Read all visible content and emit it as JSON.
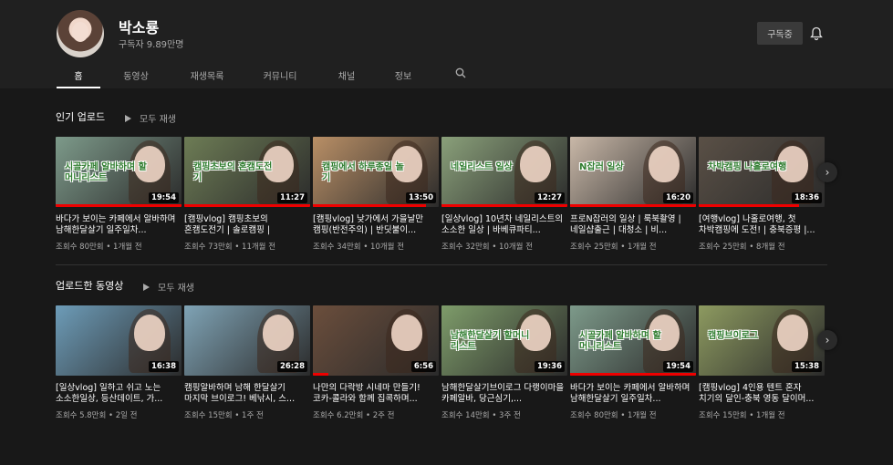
{
  "channel": {
    "name": "박소룡",
    "subscribers": "구독자 9.89만명",
    "subscribe_label": "구독중"
  },
  "tabs": [
    "홈",
    "동영상",
    "재생목록",
    "커뮤니티",
    "채널",
    "정보"
  ],
  "sections": [
    {
      "title": "인기 업로드",
      "play_all": "모두 재생",
      "videos": [
        {
          "title": "바다가 보이는 카페에서 알바하며 남해한달살기 일주일차...",
          "meta": "조회수 80만회 • 1개월 전",
          "duration": "19:54",
          "overlay": "시골카페 알바하며 할머니리스트",
          "thumb": "#7d9a8a",
          "progress": 1.0
        },
        {
          "title": "[캠핑vlog] 캠핑초보의 혼캠도전기 | 솔로캠핑 | 브이로그...",
          "meta": "조회수 73만회 • 11개월 전",
          "duration": "11:27",
          "overlay": "캠핑초보의 혼캠도전기",
          "thumb": "#6d7c55",
          "progress": 1.0
        },
        {
          "title": "[캠핑vlog] 낮가에서 가을날만 캠핑(반전주의) | 반딧불이...",
          "meta": "조회수 34만회 • 10개월 전",
          "duration": "13:50",
          "overlay": "캠핑에서 하루종일 놀기",
          "thumb": "#b98f66",
          "progress": 0.9
        },
        {
          "title": "[일상vlog] 10년차 네일리스트의 소소한 일상 | 바베큐파티...",
          "meta": "조회수 32만회 • 10개월 전",
          "duration": "12:27",
          "overlay": "네일리스트 일상",
          "thumb": "#8aa07a",
          "progress": 1.0
        },
        {
          "title": "프로N잡러의 일상 | 룩북촬영 | 네일샵출근 | 대청소 | 비...",
          "meta": "조회수 25만회 • 1개월 전",
          "duration": "16:20",
          "overlay": "N잡러 일상",
          "thumb": "#c9b8a8",
          "progress": 1.0
        },
        {
          "title": "[여행vlog] 나홀로여행, 첫 차박캠핑에 도전! | 충북증평 |...",
          "meta": "조회수 25만회 • 8개월 전",
          "duration": "18:36",
          "overlay": "차박캠핑 나홀로여행",
          "thumb": "#5a5046",
          "progress": 0.8
        }
      ]
    },
    {
      "title": "업로드한 동영상",
      "play_all": "모두 재생",
      "videos": [
        {
          "title": "[일상vlog] 일하고 쉬고 노는 소소한일상, 등산데이트, 가...",
          "meta": "조회수 5.8만회 • 2일 전",
          "duration": "16:38",
          "overlay": "",
          "thumb": "#6d9cb8",
          "progress": 0.0
        },
        {
          "title": "캠핑알바하며 남해 한달살기 마지막 브이로그! 베낚시, 스...",
          "meta": "조회수 15만회 • 1주 전",
          "duration": "26:28",
          "overlay": "",
          "thumb": "#7fa3b5",
          "progress": 0.0
        },
        {
          "title": "나만의 다락방 시네마 만들기! 코카-콜라와 함께 집콕하며...",
          "meta": "조회수 6.2만회 • 2주 전",
          "duration": "6:56",
          "overlay": "",
          "thumb": "#6b4e3c",
          "progress": 0.12
        },
        {
          "title": "남해한달살기브이로그 다랭이마을 카페알바, 당근심기,...",
          "meta": "조회수 14만회 • 3주 전",
          "duration": "19:36",
          "overlay": "남해한달살기 할머니리스트",
          "thumb": "#7e9c6a",
          "progress": 0.0
        },
        {
          "title": "바다가 보이는 카페에서 알바하며 남해한달살기 일주일차...",
          "meta": "조회수 80만회 • 1개월 전",
          "duration": "19:54",
          "overlay": "시골카페 알바하며 할머니리스트",
          "thumb": "#7d9a8a",
          "progress": 1.0
        },
        {
          "title": "[캠핑vlog] 4인용 텐트 혼자 치기의 달인-충북 영동 달이머...",
          "meta": "조회수 15만회 • 1개월 전",
          "duration": "15:38",
          "overlay": "캠핑브이로그",
          "thumb": "#8d9a60",
          "progress": 0.0
        }
      ]
    }
  ]
}
